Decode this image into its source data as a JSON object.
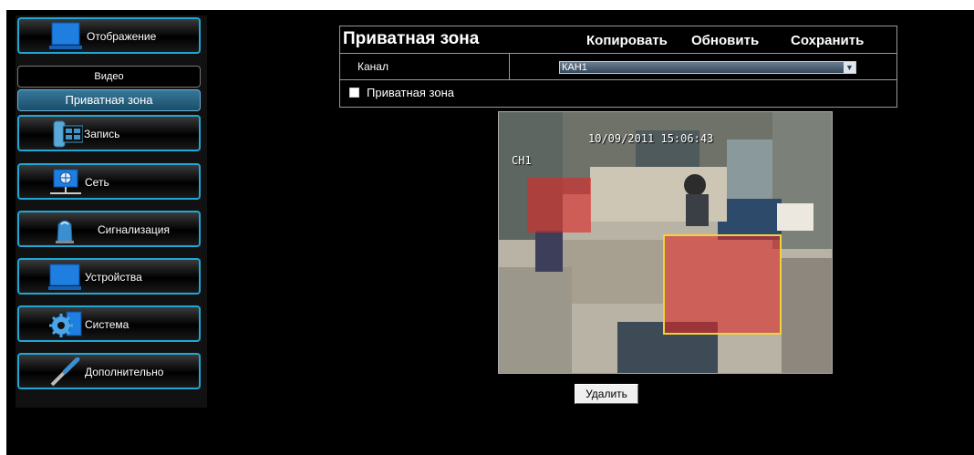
{
  "sidebar": {
    "items": [
      {
        "label": "Отображение",
        "icon": "monitor-icon"
      },
      {
        "label": "Видео"
      },
      {
        "label": "Приватная зона"
      },
      {
        "label": "Запись",
        "icon": "record-film-icon"
      },
      {
        "label": "Сеть",
        "icon": "network-icon"
      },
      {
        "label": "Сигнализация",
        "icon": "alarm-siren-icon"
      },
      {
        "label": "Устройства",
        "icon": "device-screen-icon"
      },
      {
        "label": "Система",
        "icon": "gear-icon"
      },
      {
        "label": "Дополнительно",
        "icon": "screwdriver-icon"
      }
    ]
  },
  "header": {
    "title": "Приватная зона",
    "copy_label": "Копировать",
    "refresh_label": "Обновить",
    "save_label": "Сохранить"
  },
  "channel": {
    "label": "Канал",
    "selected": "КАН1"
  },
  "privacy": {
    "checkbox_label": "Приватная зона",
    "checked": false
  },
  "video": {
    "timestamp": "10/09/2011 15:06:43",
    "channel_osd": "CH1",
    "mask_color": "#dc2828",
    "selected_mask_border": "#f2d23a"
  },
  "actions": {
    "delete_label": "Удалить"
  },
  "colors": {
    "accent": "#1fa7d6",
    "background": "#000000"
  }
}
